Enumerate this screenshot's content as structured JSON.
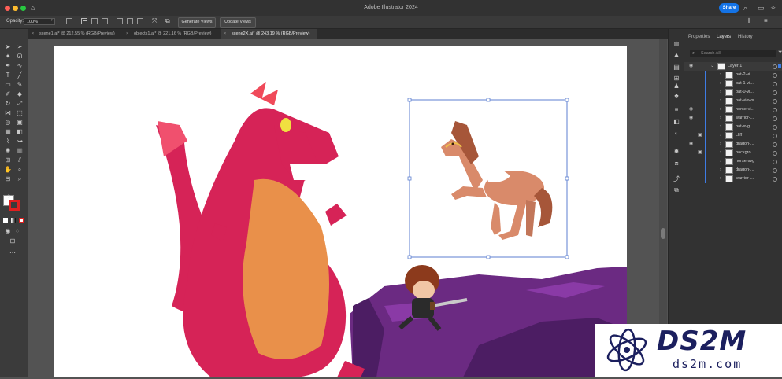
{
  "window": {
    "title": "Adobe Illustrator 2024",
    "share_label": "Share",
    "colors": {
      "red": "#ff5f57",
      "yellow": "#febc2e",
      "green": "#28c840",
      "share": "#1473e6"
    }
  },
  "controlbar": {
    "opacity_label": "Opacity:",
    "opacity_value": "100%",
    "generate_views": "Generate Views",
    "update_views": "Update Views"
  },
  "tabs": [
    {
      "label": "scene1.ai* @ 212.55 % (RGB/Preview)",
      "active": false
    },
    {
      "label": "objects1.ai* @ 221.16 % (RGB/Preview)",
      "active": false
    },
    {
      "label": "scene2X.ai* @ 243.19 % (RGB/Preview)",
      "active": true
    }
  ],
  "panel": {
    "tabs": [
      "Properties",
      "Layers",
      "History"
    ],
    "active_tab": "Layers",
    "search_placeholder": "Search All",
    "layer_name": "Layer 1",
    "sublayers": [
      "bat-2-vi...",
      "bat-1-vi...",
      "bat-0-vi...",
      "bat-views",
      "horse-vi...",
      "warrior-...",
      "bat-svg",
      "cliff",
      "dragon-...",
      "backgro...",
      "horse-svg",
      "dragon-...",
      "warrior-..."
    ]
  },
  "watermark": {
    "brand": "DS2M",
    "url": "ds2m.com"
  },
  "art_colors": {
    "dragon": "#d62357",
    "belly": "#e9904a",
    "horse": "#d98a6a",
    "horse_mane": "#a65639",
    "cliff": "#6b2a82",
    "cliff_dark": "#4c1d63",
    "warrior_hair": "#8c3a1c"
  }
}
